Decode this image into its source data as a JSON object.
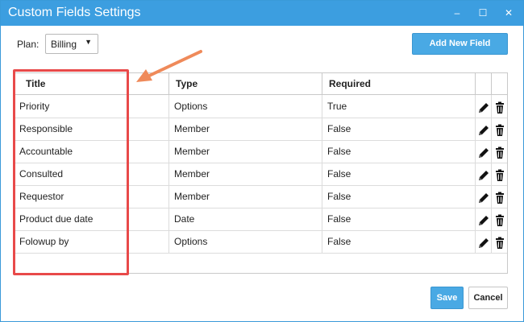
{
  "window": {
    "title": "Custom Fields Settings",
    "minimize_glyph": "–",
    "maximize_glyph": "☐",
    "close_glyph": "✕"
  },
  "plan": {
    "label": "Plan:",
    "value": "Billing",
    "caret": "▼"
  },
  "toolbar": {
    "add_label": "Add New Field"
  },
  "table": {
    "headers": {
      "title": "Title",
      "type": "Type",
      "required": "Required"
    },
    "rows": [
      {
        "title": "Priority",
        "type": "Options",
        "required": "True"
      },
      {
        "title": "Responsible",
        "type": "Member",
        "required": "False"
      },
      {
        "title": "Accountable",
        "type": "Member",
        "required": "False"
      },
      {
        "title": "Consulted",
        "type": "Member",
        "required": "False"
      },
      {
        "title": "Requestor",
        "type": "Member",
        "required": "False"
      },
      {
        "title": "Product due date",
        "type": "Date",
        "required": "False"
      },
      {
        "title": "Folowup by",
        "type": "Options",
        "required": "False"
      }
    ]
  },
  "footer": {
    "save_label": "Save",
    "cancel_label": "Cancel"
  },
  "colors": {
    "accent": "#3c9ee0",
    "annotation": "#e84a4a",
    "arrow": "#ef8a5a"
  },
  "icons": {
    "edit": "pencil-icon",
    "delete": "trash-icon"
  }
}
